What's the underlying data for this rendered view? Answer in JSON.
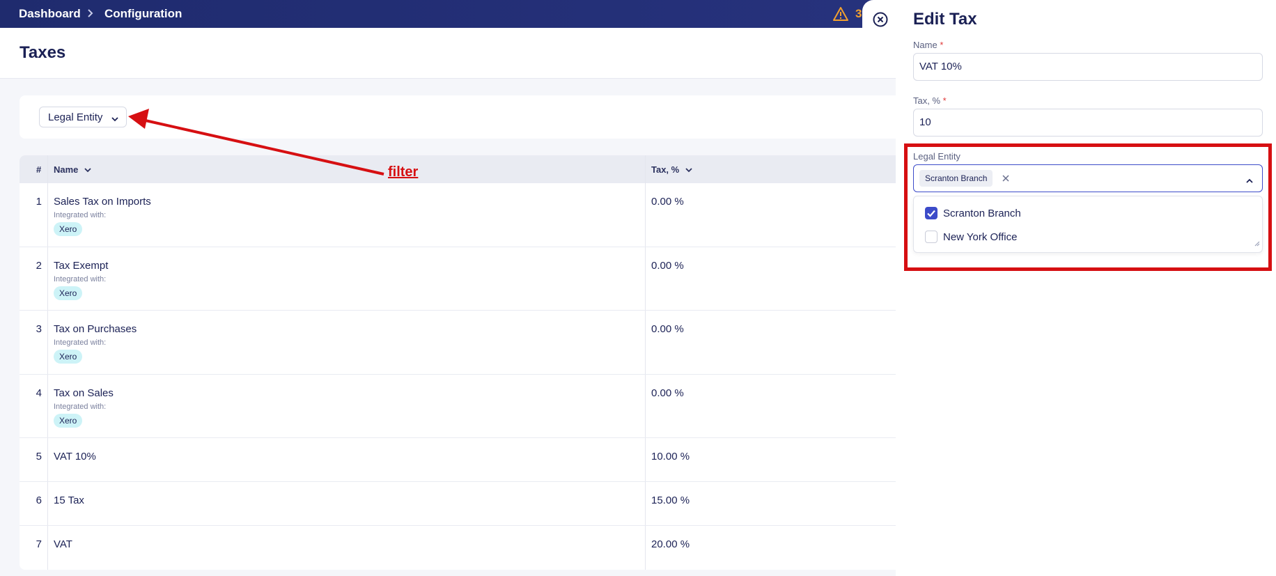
{
  "breadcrumb": {
    "home": "Dashboard",
    "current": "Configuration"
  },
  "alerts": {
    "count": "3"
  },
  "page": {
    "title": "Taxes"
  },
  "filter": {
    "label": "Legal Entity"
  },
  "annotation": {
    "text": "filter"
  },
  "table": {
    "headers": {
      "num": "#",
      "name": "Name",
      "tax": "Tax, %"
    },
    "rows": [
      {
        "num": "1",
        "name": "Sales Tax on Imports",
        "integrated": "Integrated with:",
        "badge": "Xero",
        "tax": "0.00 %"
      },
      {
        "num": "2",
        "name": "Tax Exempt",
        "integrated": "Integrated with:",
        "badge": "Xero",
        "tax": "0.00 %"
      },
      {
        "num": "3",
        "name": "Tax on Purchases",
        "integrated": "Integrated with:",
        "badge": "Xero",
        "tax": "0.00 %"
      },
      {
        "num": "4",
        "name": "Tax on Sales",
        "integrated": "Integrated with:",
        "badge": "Xero",
        "tax": "0.00 %"
      },
      {
        "num": "5",
        "name": "VAT 10%",
        "tax": "10.00 %"
      },
      {
        "num": "6",
        "name": "15 Tax",
        "tax": "15.00 %"
      },
      {
        "num": "7",
        "name": "VAT",
        "tax": "20.00 %"
      }
    ]
  },
  "panel": {
    "title": "Edit Tax",
    "name_label": "Name",
    "name_value": "VAT 10%",
    "tax_label": "Tax, %",
    "tax_value": "10",
    "required_mark": "*",
    "entity_label": "Legal Entity",
    "selected_chip": "Scranton Branch",
    "options": [
      {
        "label": "Scranton Branch",
        "checked": true
      },
      {
        "label": "New York Office",
        "checked": false
      }
    ]
  },
  "colors": {
    "topbar": "#1f2b6e",
    "accent": "#3c4bc9",
    "annotation": "#d60f12",
    "badge": "#cdf3f7"
  },
  "icons": [
    "chevron-right-icon",
    "warning-icon",
    "chevron-down-icon",
    "close-circle-icon",
    "remove-chip-icon",
    "chevron-up-icon",
    "checkbox-checked-icon",
    "resize-handle-icon"
  ]
}
